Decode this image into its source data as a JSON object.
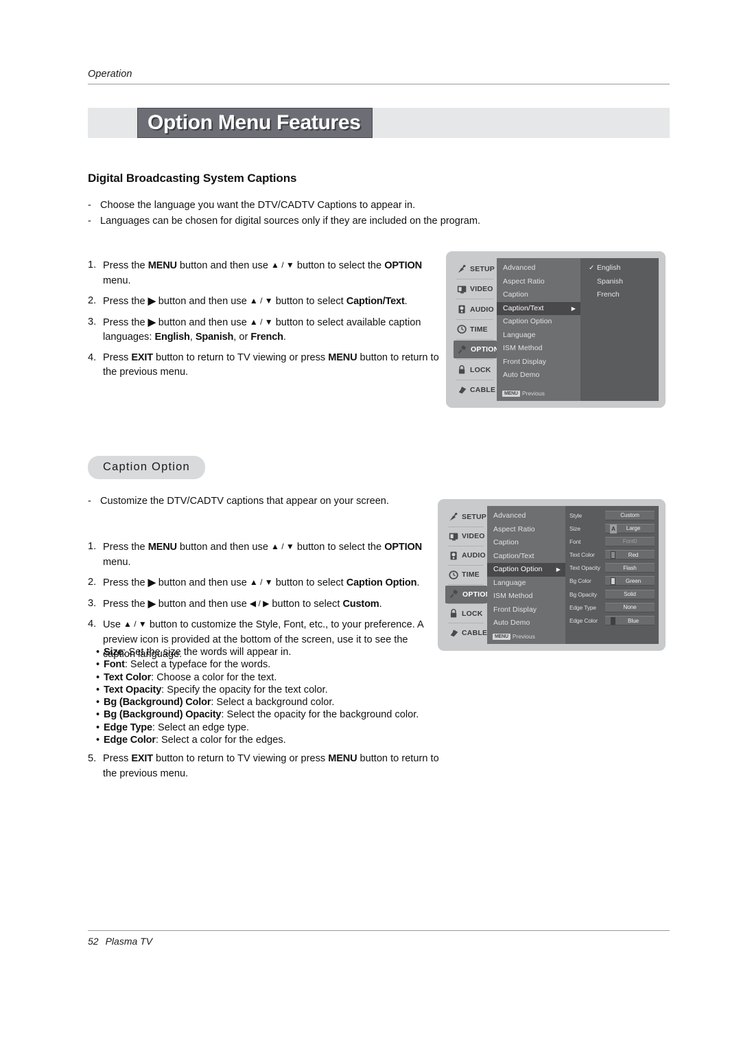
{
  "running_header": {
    "label": "Operation"
  },
  "title_band": {
    "title": "Option Menu Features"
  },
  "section_dbs": {
    "heading": "Digital Broadcasting System Captions",
    "dashes": [
      "Choose the language you want the DTV/CADTV Captions to appear in.",
      "Languages can be chosen for digital sources only if they are included on the program."
    ],
    "steps": [
      {
        "num": "1.",
        "pre": "Press the ",
        "b1": "MENU",
        "mid": " button and then use ",
        "arrows": "▲ / ▼",
        "mid2": " button to select the ",
        "b2": "OPTION",
        "post": " menu."
      },
      {
        "num": "2.",
        "pre": "Press the ",
        "b1": "▶",
        "mid": " button and then use ",
        "arrows": "▲ / ▼",
        "mid2": " button to select ",
        "b2": "Caption/Text",
        "post": "."
      },
      {
        "num": "3.",
        "pre": "Press the ",
        "b1": "▶",
        "mid": " button and then use ",
        "arrows": "▲ / ▼",
        "mid2": " button to select available caption languages: ",
        "b2": "English",
        "sep1": ", ",
        "b3": "Spanish",
        "sep2": ", or ",
        "b4": "French",
        "post": "."
      },
      {
        "num": "4.",
        "pre": "Press ",
        "b1": "EXIT",
        "mid": " button to return to TV viewing or press ",
        "b2": "MENU",
        "post": " button to return to the previous menu."
      }
    ]
  },
  "section_caption_option": {
    "pill_heading": "Caption Option",
    "dashes": [
      "Customize the DTV/CADTV captions that appear on your screen."
    ],
    "steps": [
      {
        "num": "1.",
        "pre": "Press the ",
        "b1": "MENU",
        "mid": " button and then use ",
        "arrows": "▲ / ▼",
        "mid2": " button to select the ",
        "b2": "OPTION",
        "post": " menu."
      },
      {
        "num": "2.",
        "pre": "Press the ",
        "b1": "▶",
        "mid": " button and then use ",
        "arrows": "▲ / ▼",
        "mid2": " button to select ",
        "b2": "Caption Option",
        "post": "."
      },
      {
        "num": "3.",
        "pre": "Press the ",
        "b1": "▶",
        "mid": " button and then use ",
        "arrows": "◀ / ▶",
        "mid2": " button to select ",
        "b2": "Custom",
        "post": "."
      },
      {
        "num": "4.",
        "pre": "Use ",
        "arrows": "▲ / ▼",
        "mid2": " button to customize the Style, Font, etc., to your preference. A preview icon is provided at the bottom of the screen, use it to see the caption language."
      }
    ],
    "bullets": [
      {
        "term": "Size",
        "desc": ": Set the size the words will appear in."
      },
      {
        "term": "Font",
        "desc": ": Select a typeface for the words."
      },
      {
        "term": "Text Color",
        "desc": ": Choose a color for the text."
      },
      {
        "term": "Text Opacity",
        "desc": ": Specify the opacity for the text color."
      },
      {
        "term": "Bg (Background) Color",
        "desc": ": Select a background color."
      },
      {
        "term": "Bg (Background) Opacity",
        "desc": ": Select the opacity for the background color."
      },
      {
        "term": "Edge Type",
        "desc": ": Select an edge type."
      },
      {
        "term": "Edge Color",
        "desc": ": Select a color for the edges."
      }
    ],
    "step5": {
      "num": "5.",
      "pre": "Press ",
      "b1": "EXIT",
      "mid": " button to return to TV viewing or press ",
      "b2": "MENU",
      "post": " button to return to the previous menu."
    }
  },
  "osd_menu_1": {
    "sidebar": [
      {
        "label": "SETUP",
        "icon": "satellite-dish-icon",
        "active": false
      },
      {
        "label": "VIDEO",
        "icon": "monitor-icon",
        "active": false
      },
      {
        "label": "AUDIO",
        "icon": "speaker-icon",
        "active": false
      },
      {
        "label": "TIME",
        "icon": "clock-icon",
        "active": false
      },
      {
        "label": "OPTION",
        "icon": "plug-icon",
        "active": true
      },
      {
        "label": "LOCK",
        "icon": "padlock-icon",
        "active": false
      },
      {
        "label": "CABLE",
        "icon": "cable-icon",
        "active": false
      }
    ],
    "items": [
      {
        "label": "Advanced",
        "selected": false,
        "submenu": false
      },
      {
        "label": "Aspect Ratio",
        "selected": false,
        "submenu": false
      },
      {
        "label": "Caption",
        "selected": false,
        "submenu": false
      },
      {
        "label": "Caption/Text",
        "selected": true,
        "submenu": true
      },
      {
        "label": "Caption Option",
        "selected": false,
        "submenu": false
      },
      {
        "label": "Language",
        "selected": false,
        "submenu": false
      },
      {
        "label": "ISM Method",
        "selected": false,
        "submenu": false
      },
      {
        "label": "Front Display",
        "selected": false,
        "submenu": false
      },
      {
        "label": "Auto Demo",
        "selected": false,
        "submenu": false
      }
    ],
    "previous": {
      "badge": "MENU",
      "label": "Previous"
    },
    "submenu": [
      {
        "label": "English",
        "checked": true
      },
      {
        "label": "Spanish",
        "checked": false
      },
      {
        "label": "French",
        "checked": false
      }
    ]
  },
  "osd_menu_2": {
    "sidebar": [
      {
        "label": "SETUP",
        "icon": "satellite-dish-icon",
        "active": false
      },
      {
        "label": "VIDEO",
        "icon": "monitor-icon",
        "active": false
      },
      {
        "label": "AUDIO",
        "icon": "speaker-icon",
        "active": false
      },
      {
        "label": "TIME",
        "icon": "clock-icon",
        "active": false
      },
      {
        "label": "OPTION",
        "icon": "plug-icon",
        "active": true
      },
      {
        "label": "LOCK",
        "icon": "padlock-icon",
        "active": false
      },
      {
        "label": "CABLE",
        "icon": "cable-icon",
        "active": false
      }
    ],
    "items": [
      {
        "label": "Advanced",
        "selected": false,
        "submenu": false
      },
      {
        "label": "Aspect Ratio",
        "selected": false,
        "submenu": false
      },
      {
        "label": "Caption",
        "selected": false,
        "submenu": false
      },
      {
        "label": "Caption/Text",
        "selected": false,
        "submenu": false
      },
      {
        "label": "Caption Option",
        "selected": true,
        "submenu": true
      },
      {
        "label": "Language",
        "selected": false,
        "submenu": false
      },
      {
        "label": "ISM Method",
        "selected": false,
        "submenu": false
      },
      {
        "label": "Front Display",
        "selected": false,
        "submenu": false
      },
      {
        "label": "Auto Demo",
        "selected": false,
        "submenu": false
      }
    ],
    "previous": {
      "badge": "MENU",
      "label": "Previous"
    },
    "settings": [
      {
        "label": "Style",
        "value": "Custom",
        "swatch": "none"
      },
      {
        "label": "Size",
        "value": "Large",
        "swatch": "letter"
      },
      {
        "label": "Font",
        "value": "Font0",
        "swatch": "none",
        "dim": true
      },
      {
        "label": "Text Color",
        "value": "Red",
        "swatch": "color",
        "swatch_color": "#8a8b8d"
      },
      {
        "label": "Text Opacity",
        "value": "Flash",
        "swatch": "none"
      },
      {
        "label": "Bg Color",
        "value": "Green",
        "swatch": "color",
        "swatch_color": "#d0d1d2"
      },
      {
        "label": "Bg Opacity",
        "value": "Solid",
        "swatch": "none"
      },
      {
        "label": "Edge Type",
        "value": "None",
        "swatch": "none"
      },
      {
        "label": "Edge Color",
        "value": "Blue",
        "swatch": "color",
        "swatch_color": "#3f4042"
      }
    ]
  },
  "footer": {
    "page_number": "52",
    "product": "Plasma TV"
  }
}
